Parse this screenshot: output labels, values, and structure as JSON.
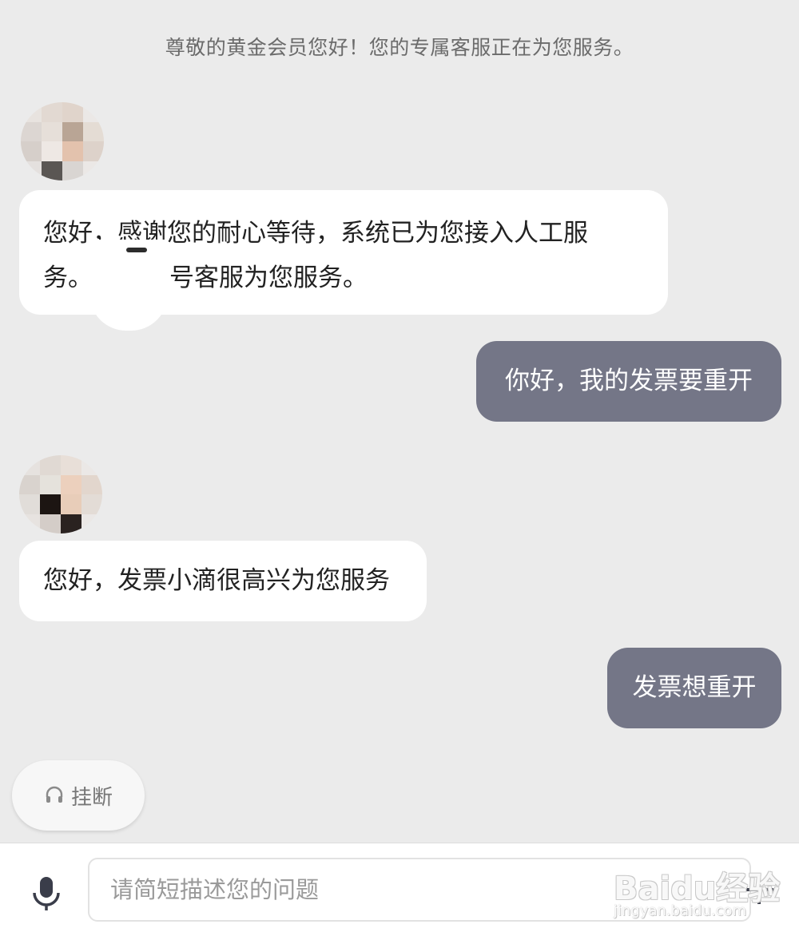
{
  "header": {
    "notice": "尊敬的黄金会员您好！您的专属客服正在为您服务。"
  },
  "messages": [
    {
      "from": "agent",
      "line1": "您好，感谢您的耐心等待，系统已为您接入人工服",
      "line2_prefix": "务。",
      "line2_suffix": "号客服为您服务。"
    },
    {
      "from": "user",
      "text": "你好，我的发票要重开"
    },
    {
      "from": "agent",
      "text": "您好，发票小滴很高兴为您服务"
    },
    {
      "from": "user",
      "text": "发票想重开"
    }
  ],
  "hangup": {
    "label": "挂断",
    "icon": "headset-icon"
  },
  "input": {
    "placeholder": "请简短描述您的问题"
  },
  "icons": {
    "voice": "microphone-icon",
    "more": "plus-icon"
  },
  "watermark": {
    "logo": "Baidu经验",
    "url": "jingyan.baidu.com"
  },
  "colors": {
    "user_bubble": "#747687",
    "agent_bubble": "#ffffff",
    "background": "#ebebeb"
  }
}
